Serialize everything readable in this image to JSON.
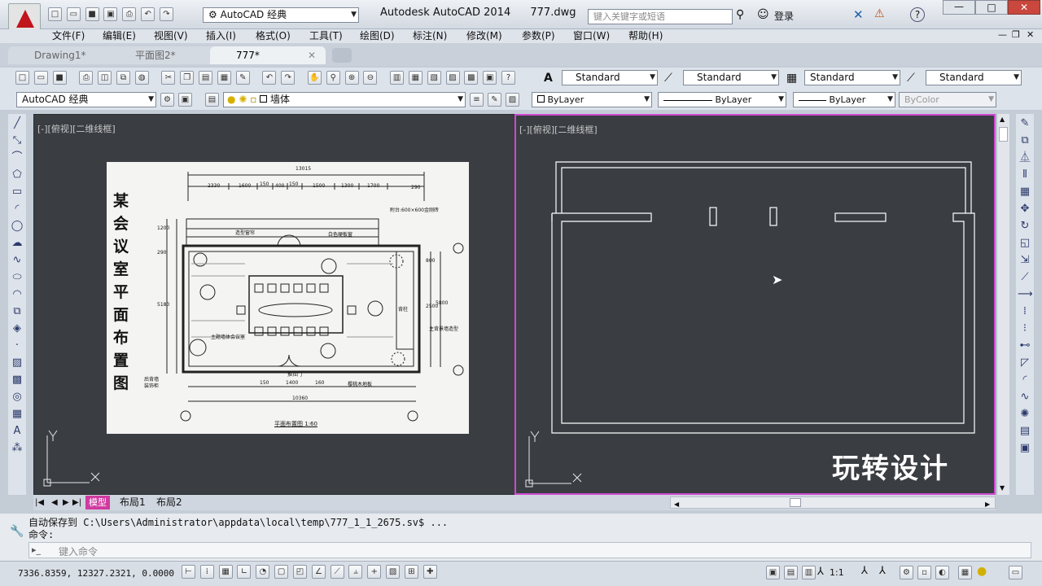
{
  "app": {
    "title": "Autodesk AutoCAD 2014",
    "filename": "777.dwg",
    "workspace": "AutoCAD 经典",
    "search_placeholder": "键入关键字或短语",
    "login": "登录",
    "help": "?"
  },
  "menu": [
    "文件(F)",
    "编辑(E)",
    "视图(V)",
    "插入(I)",
    "格式(O)",
    "工具(T)",
    "绘图(D)",
    "标注(N)",
    "修改(M)",
    "参数(P)",
    "窗口(W)",
    "帮助(H)"
  ],
  "doc_tabs": [
    {
      "label": "Drawing1*",
      "active": false
    },
    {
      "label": "平面图2*",
      "active": false
    },
    {
      "label": "777*",
      "active": true
    }
  ],
  "styles_toolbar": {
    "text_style": "Standard",
    "dim_style": "Standard",
    "table_style": "Standard",
    "mleader_style": "Standard"
  },
  "layers_toolbar": {
    "workspace": "AutoCAD 经典",
    "layer": "墙体",
    "color": "ByLayer",
    "linetype": "ByLayer",
    "lineweight": "ByLayer",
    "plotstyle": "ByColor"
  },
  "viewports": {
    "left_label": "[-][俯视][二维线框]",
    "right_label": "[-][俯视][二维线框]",
    "watermark": "玩转设计"
  },
  "plan_image": {
    "title_vertical": "某会议室平面布置图",
    "caption": "平面布置图 1:60",
    "top_total": "13015",
    "top_dims": [
      "2330",
      "1600",
      "150",
      "400",
      "150",
      "1500",
      "1300",
      "1700",
      "290"
    ],
    "bottom_dims": [
      "150",
      "1400",
      "160",
      "10360"
    ],
    "left_dims": [
      "5180",
      "290",
      "1200"
    ],
    "right_dims": [
      "800",
      "2500",
      "5800"
    ],
    "notes": [
      "附台:600×600金刚砖",
      "造型窗帘",
      "白色硬板窗",
      "主背景墙造型",
      "主题墙体会议室",
      "背柱",
      "推拉门",
      "樱桃木地板",
      "后背墙",
      "装饰柜"
    ]
  },
  "layout_tabs": [
    "模型",
    "布局1",
    "布局2"
  ],
  "command": {
    "history_1": "自动保存到 C:\\Users\\Administrator\\appdata\\local\\temp\\777_1_1_2675.sv$ ...",
    "history_2": "命令:",
    "prompt": "键入命令"
  },
  "status": {
    "coords": "7336.8359, 12327.2321, 0.0000",
    "annotation_scale": "1:1"
  }
}
